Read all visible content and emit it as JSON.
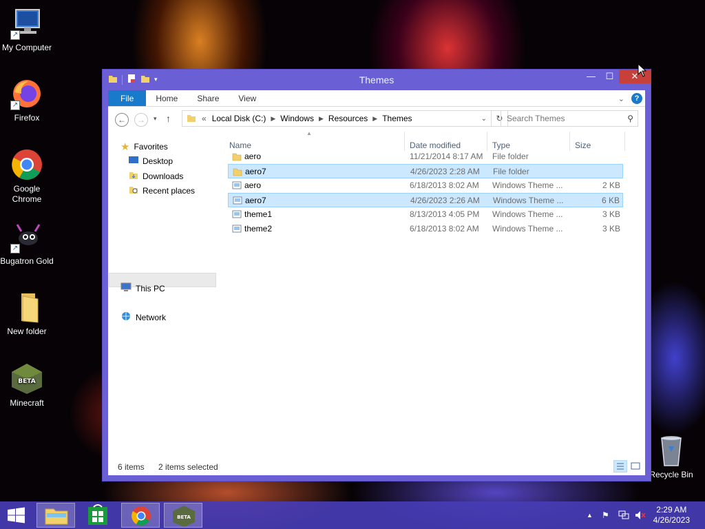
{
  "desktop": {
    "icons": [
      {
        "label": "My Computer"
      },
      {
        "label": "Firefox"
      },
      {
        "label": "Google Chrome"
      },
      {
        "label": "Bugatron Gold"
      },
      {
        "label": "New folder"
      },
      {
        "label": "Minecraft"
      },
      {
        "label": "Recycle Bin"
      }
    ]
  },
  "window": {
    "title": "Themes",
    "ribbon_tabs": [
      "File",
      "Home",
      "Share",
      "View"
    ],
    "help_label": "?",
    "address": {
      "prefix": "«",
      "segments": [
        "Local Disk (C:)",
        "Windows",
        "Resources",
        "Themes"
      ]
    },
    "search_placeholder": "Search Themes",
    "nav": {
      "favorites": "Favorites",
      "desktop": "Desktop",
      "downloads": "Downloads",
      "recent": "Recent places",
      "this_pc": "This PC",
      "network": "Network"
    },
    "columns": [
      "Name",
      "Date modified",
      "Type",
      "Size"
    ],
    "files": [
      {
        "name": "aero",
        "date": "11/21/2014 8:17 AM",
        "type": "File folder",
        "size": "",
        "kind": "folder",
        "selected": false
      },
      {
        "name": "aero7",
        "date": "4/26/2023 2:28 AM",
        "type": "File folder",
        "size": "",
        "kind": "folder",
        "selected": true
      },
      {
        "name": "aero",
        "date": "6/18/2013 8:02 AM",
        "type": "Windows Theme ...",
        "size": "2 KB",
        "kind": "theme",
        "selected": false
      },
      {
        "name": "aero7",
        "date": "4/26/2023 2:26 AM",
        "type": "Windows Theme ...",
        "size": "6 KB",
        "kind": "theme",
        "selected": true
      },
      {
        "name": "theme1",
        "date": "8/13/2013 4:05 PM",
        "type": "Windows Theme ...",
        "size": "3 KB",
        "kind": "theme",
        "selected": false
      },
      {
        "name": "theme2",
        "date": "6/18/2013 8:02 AM",
        "type": "Windows Theme ...",
        "size": "3 KB",
        "kind": "theme",
        "selected": false
      }
    ],
    "status": {
      "item_count": "6 items",
      "selection": "2 items selected"
    }
  },
  "taskbar": {
    "time": "2:29 AM",
    "date": "4/26/2023"
  },
  "colors": {
    "window_frame": "#6a5fd4",
    "ribbon_file": "#1979ca",
    "selection": "#cce8ff",
    "close_button": "#c7403a"
  }
}
